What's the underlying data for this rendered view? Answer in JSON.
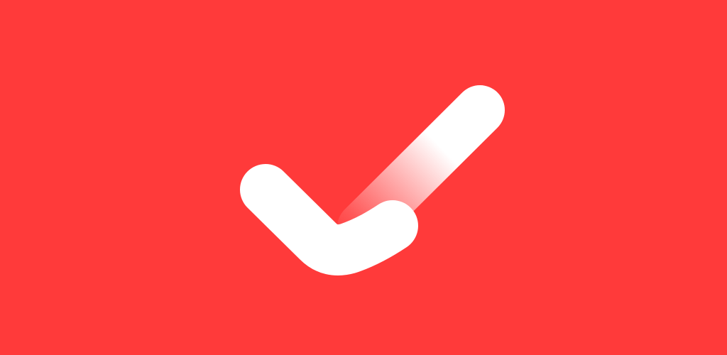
{
  "banner": {
    "background_color": "#ff3a3a",
    "icon": "checkmark-icon",
    "icon_color": "#ffffff"
  }
}
